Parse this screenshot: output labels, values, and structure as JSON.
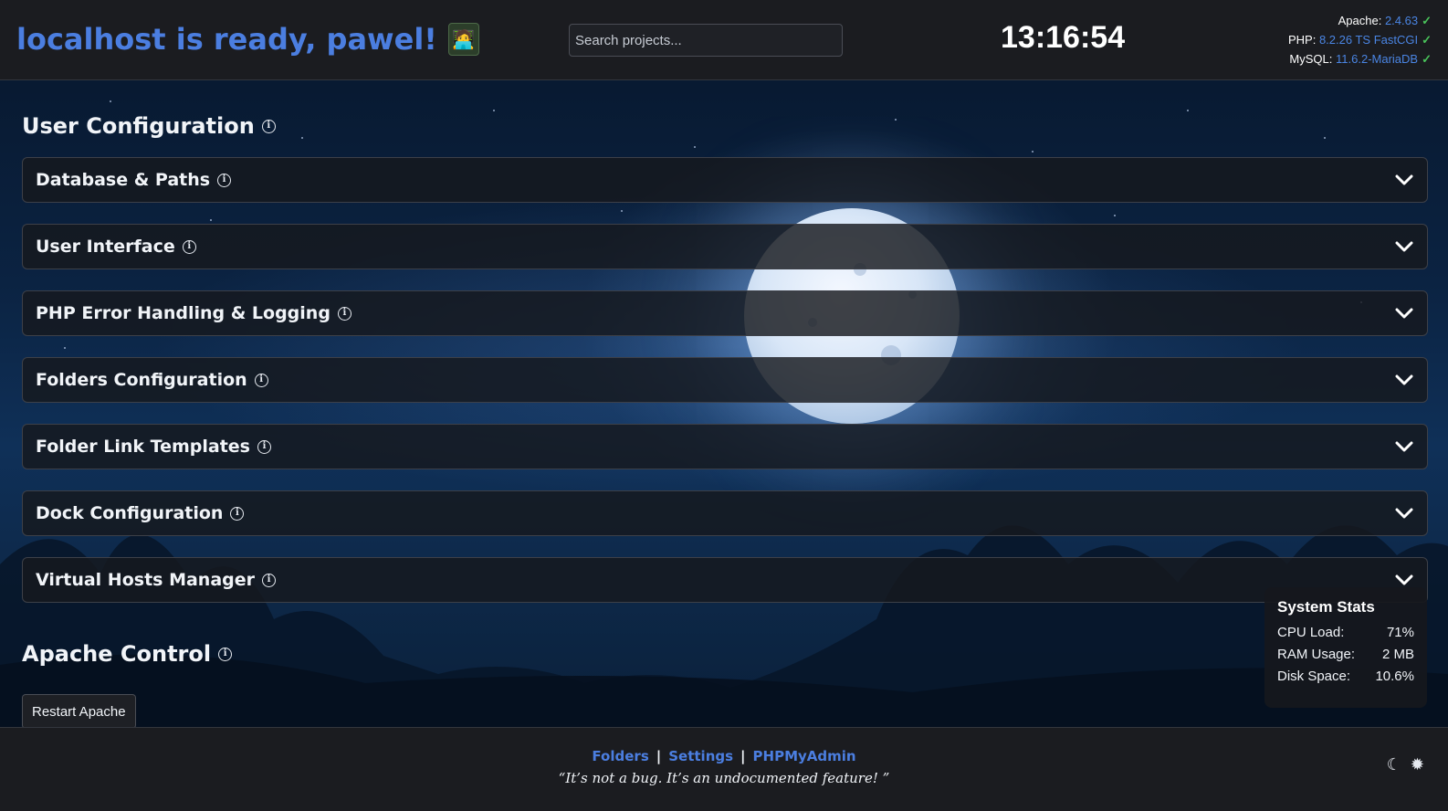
{
  "header": {
    "greeting": "localhost is ready, pawel!",
    "avatar_icon": "coder-avatar-icon",
    "search_placeholder": "Search projects...",
    "clock": "13:16:54",
    "versions": [
      {
        "label": "Apache:",
        "value": "2.4.63",
        "status": "ok"
      },
      {
        "label": "PHP:",
        "value": "8.2.26 TS FastCGI",
        "status": "ok"
      },
      {
        "label": "MySQL:",
        "value": "11.6.2-MariaDB",
        "status": "ok"
      }
    ]
  },
  "user_config": {
    "title": "User Configuration",
    "sections": [
      {
        "label": "Database & Paths"
      },
      {
        "label": "User Interface"
      },
      {
        "label": "PHP Error Handling & Logging"
      },
      {
        "label": "Folders Configuration"
      },
      {
        "label": "Folder Link Templates"
      },
      {
        "label": "Dock Configuration"
      },
      {
        "label": "Virtual Hosts Manager"
      }
    ]
  },
  "apache_control": {
    "title": "Apache Control",
    "restart_label": "Restart Apache"
  },
  "system_stats": {
    "title": "System Stats",
    "rows": [
      {
        "label": "CPU Load:",
        "value": "71%"
      },
      {
        "label": "RAM Usage:",
        "value": "2 MB"
      },
      {
        "label": "Disk Space:",
        "value": "10.6%"
      }
    ]
  },
  "footer": {
    "links": [
      "Folders",
      "Settings",
      "PHPMyAdmin"
    ],
    "separator": "|",
    "quote": "It’s not a bug. It’s an undocumented feature!",
    "quote_open": "“",
    "quote_close": "”"
  },
  "colors": {
    "accent": "#4b7ee0",
    "ok": "#49c25a",
    "panel": "#1b1c20"
  }
}
